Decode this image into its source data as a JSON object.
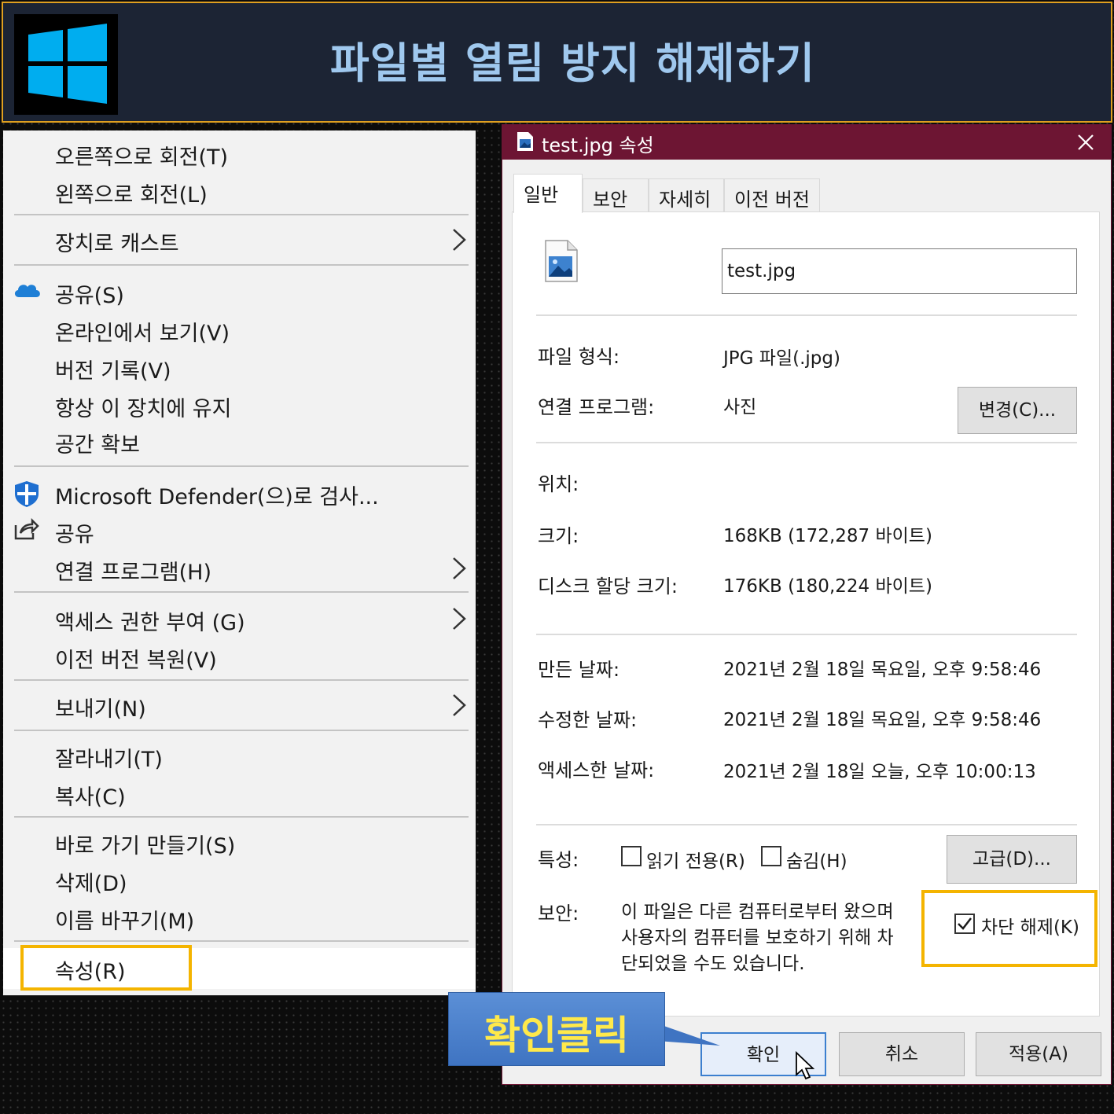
{
  "banner": {
    "title": "파일별 열림 방지 해제하기",
    "logo_icon": "windows-logo",
    "colors": {
      "background": "#1c2434",
      "border": "#e0a020",
      "title": "#9fc8ee",
      "logo": "#00adef"
    }
  },
  "context_menu": {
    "items": [
      {
        "label": "오른쪽으로 회전(T)"
      },
      {
        "label": "왼쪽으로 회전(L)"
      },
      {
        "label": "장치로 캐스트",
        "submenu": true
      },
      {
        "label": "공유(S)",
        "icon": "onedrive-cloud-icon"
      },
      {
        "label": "온라인에서 보기(V)"
      },
      {
        "label": "버전 기록(V)"
      },
      {
        "label": "항상 이 장치에 유지"
      },
      {
        "label": "공간 확보"
      },
      {
        "label": "Microsoft Defender(으)로 검사...",
        "icon": "defender-shield-icon"
      },
      {
        "label": "공유",
        "icon": "share-icon"
      },
      {
        "label": "연결 프로그램(H)",
        "submenu": true
      },
      {
        "label": "액세스 권한 부여 (G)",
        "submenu": true
      },
      {
        "label": "이전 버전 복원(V)"
      },
      {
        "label": "보내기(N)",
        "submenu": true
      },
      {
        "label": "잘라내기(T)"
      },
      {
        "label": "복사(C)"
      },
      {
        "label": "바로 가기 만들기(S)"
      },
      {
        "label": "삭제(D)"
      },
      {
        "label": "이름 바꾸기(M)"
      },
      {
        "label": "속성(R)",
        "highlighted": true
      }
    ]
  },
  "dialog": {
    "title": "test.jpg 속성",
    "tabs": [
      "일반",
      "보안",
      "자세히",
      "이전 버전"
    ],
    "active_tab": "일반",
    "file_name": "test.jpg",
    "file_type_label": "파일 형식:",
    "file_type_value": "JPG 파일(.jpg)",
    "opens_with_label": "연결 프로그램:",
    "opens_with_value": "사진",
    "change_button": "변경(C)...",
    "location_label": "위치:",
    "size_label": "크기:",
    "size_value": "168KB (172,287 바이트)",
    "size_on_disk_label": "디스크 할당 크기:",
    "size_on_disk_value": "176KB (180,224 바이트)",
    "created_label": "만든 날짜:",
    "created_value": "2021년 2월 18일 목요일, 오후 9:58:46",
    "modified_label": "수정한 날짜:",
    "modified_value": "2021년 2월 18일 목요일, 오후 9:58:46",
    "accessed_label": "액세스한 날짜:",
    "accessed_value": "2021년 2월 18일 오늘, 오후 10:00:13",
    "attributes_label": "특성:",
    "readonly_label": "읽기 전용(R)",
    "readonly_checked": false,
    "hidden_label": "숨김(H)",
    "hidden_checked": false,
    "advanced_button": "고급(D)...",
    "security_label": "보안:",
    "security_text_line1": "이 파일은 다른 컴퓨터로부터 왔으며",
    "security_text_line2": "사용자의 컴퓨터를 보호하기 위해 차",
    "security_text_line3": "단되었을 수도 있습니다.",
    "unblock_label": "차단 해제(K)",
    "unblock_checked": true,
    "ok_button": "확인",
    "cancel_button": "취소",
    "apply_button": "적용(A)",
    "colors": {
      "titlebar": "#6d1533",
      "highlight": "#f4b400"
    }
  },
  "callout": {
    "text": "확인클릭",
    "colors": {
      "background": "#4a80cc",
      "text": "#ffe94a"
    }
  }
}
